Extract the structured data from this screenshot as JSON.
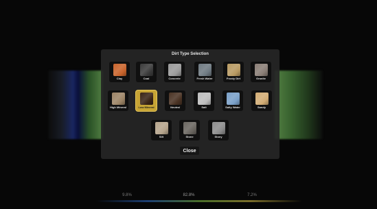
{
  "dialog": {
    "title": "Dirt Type Selection",
    "close_label": "Close",
    "selected": "Low Mineral"
  },
  "dirt_types": [
    {
      "label": "Clay",
      "color": "#c9642c"
    },
    {
      "label": "Coal",
      "color": "#3b3b3b"
    },
    {
      "label": "Concrete",
      "color": "#9a9a9a"
    },
    {
      "label": "Fresh Water",
      "color": "#6f7a82"
    },
    {
      "label": "Frosty Dirt",
      "color": "#b89a62"
    },
    {
      "label": "Granite",
      "color": "#8a7e76"
    },
    {
      "label": "High Mineral",
      "color": "#9c8466"
    },
    {
      "label": "Low Mineral",
      "color": "#3a2416"
    },
    {
      "label": "Neutral",
      "color": "#4a3324"
    },
    {
      "label": "Salt",
      "color": "#bdbdbd"
    },
    {
      "label": "Salty Water",
      "color": "#7aa0c8"
    },
    {
      "label": "Sandy",
      "color": "#d2ac74"
    },
    {
      "label": "Silt",
      "color": "#b5a48c"
    },
    {
      "label": "Stone",
      "color": "#6a6660"
    },
    {
      "label": "Stony",
      "color": "#8c8c8c"
    }
  ],
  "footer": {
    "left_value": "9.8%",
    "center_value": "82.8%",
    "right_value": "7.2%"
  }
}
